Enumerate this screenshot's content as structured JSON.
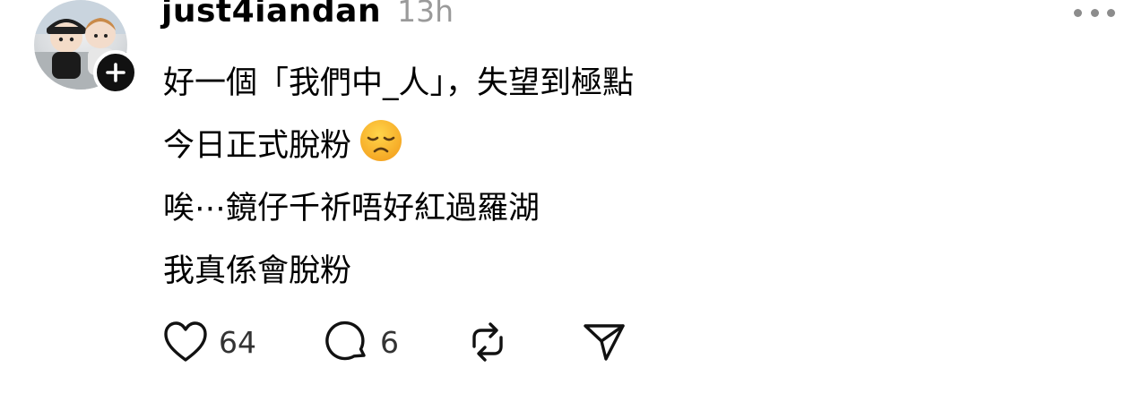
{
  "post": {
    "username": "just4iandan",
    "timestamp": "13h",
    "lines": [
      "好一個「我們中_人」，失望到極點",
      "今日正式脫粉",
      "唉⋯鏡仔千祈唔好紅過羅湖",
      "我真係會脫粉"
    ],
    "emoji": "disappointed-face"
  },
  "actions": {
    "like_count": "64",
    "comment_count": "6"
  },
  "icons": [
    "heart-icon",
    "comment-icon",
    "repost-icon",
    "share-icon",
    "more-icon",
    "plus-icon"
  ]
}
